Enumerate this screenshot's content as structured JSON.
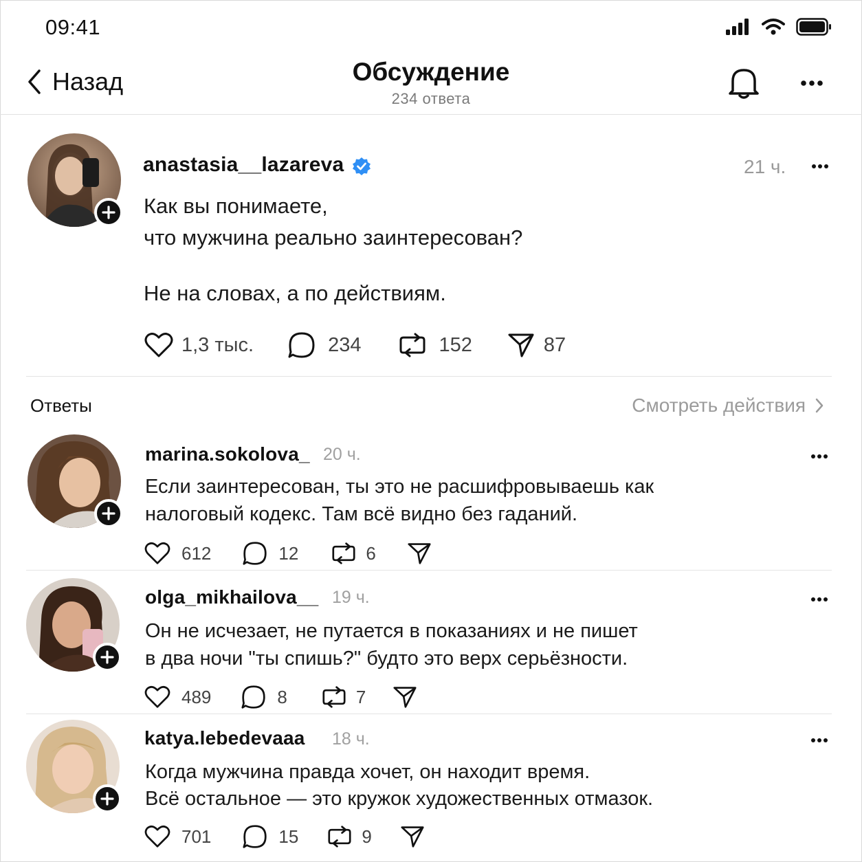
{
  "status_bar": {
    "time": "09:41"
  },
  "header": {
    "back_label": "Назад",
    "title": "Обсуждение",
    "subtitle": "234 ответа"
  },
  "post": {
    "username": "anastasia__lazareva",
    "verified": true,
    "time": "21 ч.",
    "line1": "Как вы понимаете,",
    "line2": "что мужчина реально заинтересован?",
    "line3": "Не на словах, а по действиям.",
    "likes": "1,3 тыс.",
    "comments": "234",
    "reposts": "152",
    "shares": "87"
  },
  "replies_section": {
    "label": "Ответы",
    "see_activity": "Смотреть действия"
  },
  "replies": [
    {
      "username": "marina.sokolova_",
      "time": "20 ч.",
      "line1": "Если заинтересован, ты это не расшифровываешь как",
      "line2": "налоговый кодекс. Там всё видно без гаданий.",
      "likes": "612",
      "comments": "12",
      "reposts": "6"
    },
    {
      "username": "olga_mikhailova__",
      "time": "19 ч.",
      "line1": "Он не исчезает, не путается в показаниях и не пишет",
      "line2": "в два ночи \"ты спишь?\" будто это верх серьёзности.",
      "likes": "489",
      "comments": "8",
      "reposts": "7"
    },
    {
      "username": "katya.lebedevaaa",
      "time": "18 ч.",
      "line1": "Когда мужчина правда хочет, он находит время.",
      "line2": "Всё остальное — это кружок художественных отмазок.",
      "likes": "701",
      "comments": "15",
      "reposts": "9"
    }
  ],
  "colors": {
    "verified": "#2f8ff5",
    "muted": "#9a9a9a",
    "text": "#111111"
  }
}
